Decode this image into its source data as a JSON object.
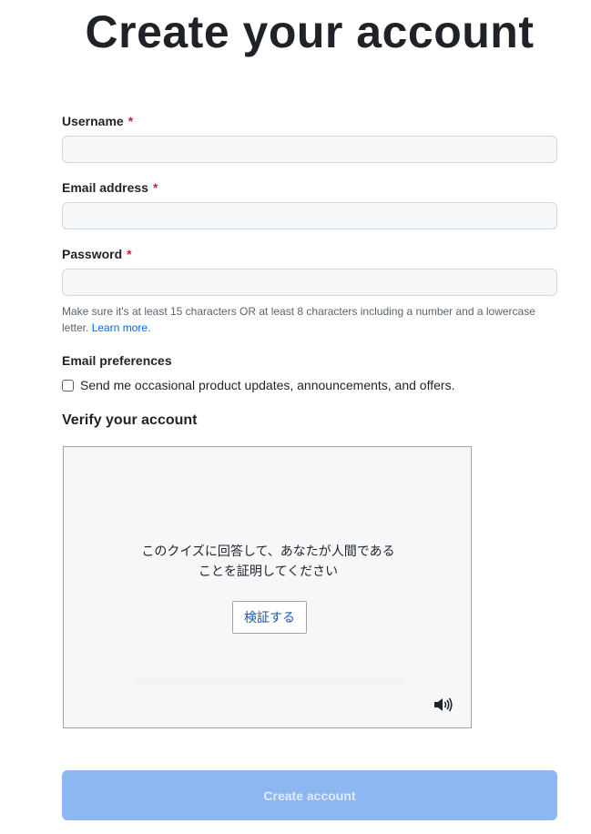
{
  "page": {
    "title": "Create your account"
  },
  "form": {
    "username": {
      "label": "Username",
      "required_marker": "*",
      "value": "",
      "placeholder": ""
    },
    "email": {
      "label": "Email address",
      "required_marker": "*",
      "value": "",
      "placeholder": ""
    },
    "password": {
      "label": "Password",
      "required_marker": "*",
      "value": "",
      "placeholder": ""
    },
    "password_hint": "Make sure it's at least 15 characters OR at least 8 characters including a number and a lowercase letter.",
    "password_hint_link": "Learn more.",
    "email_preferences": {
      "label": "Email preferences",
      "checkbox_label": "Send me occasional product updates, announcements, and offers.",
      "checked": false
    },
    "verify": {
      "label": "Verify your account",
      "captcha_prompt": "このクイズに回答して、あなたが人間であることを証明してください",
      "captcha_button": "検証する",
      "audio_icon": "speaker-icon"
    },
    "submit_label": "Create account"
  },
  "colors": {
    "required": "#d1242f",
    "link": "#0969da",
    "submit_disabled_bg": "#8db7f0",
    "captcha_button_text": "#1a5aa8"
  }
}
